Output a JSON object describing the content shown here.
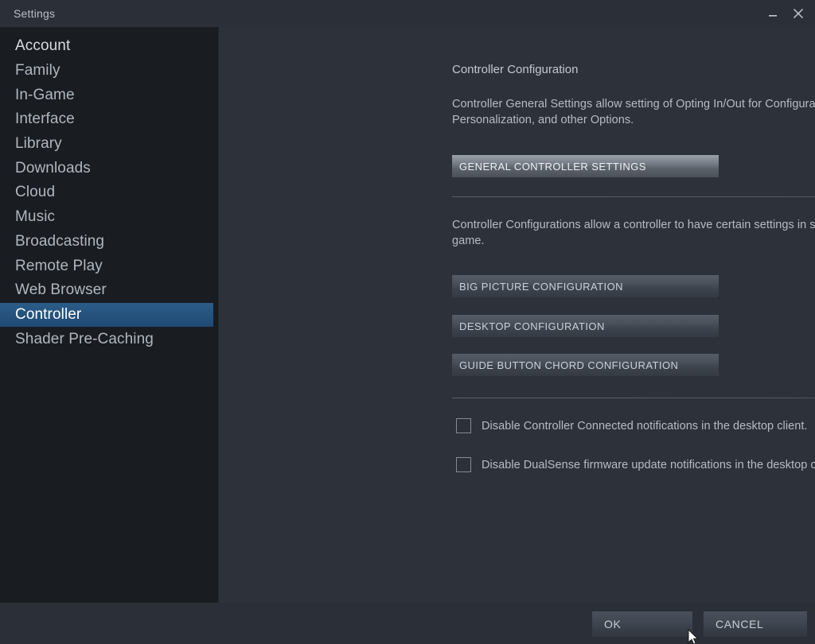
{
  "window": {
    "title": "Settings",
    "controls": [
      {
        "name": "minimize",
        "glyph": "minimize-icon"
      },
      {
        "name": "close",
        "glyph": "close-icon"
      }
    ]
  },
  "sidebar": {
    "items": [
      {
        "label": "Account",
        "selected": false
      },
      {
        "label": "Family",
        "selected": false
      },
      {
        "label": "In-Game",
        "selected": false
      },
      {
        "label": "Interface",
        "selected": false
      },
      {
        "label": "Library",
        "selected": false
      },
      {
        "label": "Downloads",
        "selected": false
      },
      {
        "label": "Cloud",
        "selected": false
      },
      {
        "label": "Music",
        "selected": false
      },
      {
        "label": "Broadcasting",
        "selected": false
      },
      {
        "label": "Remote Play",
        "selected": false
      },
      {
        "label": "Web Browser",
        "selected": false
      },
      {
        "label": "Controller",
        "selected": true
      },
      {
        "label": "Shader Pre-Caching",
        "selected": false
      }
    ],
    "selected_label": "Controller"
  },
  "main": {
    "section_title": "Controller Configuration",
    "description_1": "Controller General Settings allow setting of Opting In/Out for Configuration Support, Personalization, and other Options.",
    "general_settings_button": "GENERAL CONTROLLER SETTINGS",
    "description_2": "Controller Configurations allow a controller to have certain settings in specific contexts outside of game.",
    "big_picture_button": "BIG PICTURE CONFIGURATION",
    "desktop_button": "DESKTOP CONFIGURATION",
    "guide_button": "GUIDE BUTTON CHORD CONFIGURATION",
    "checkboxes": [
      {
        "label": "Disable Controller Connected notifications in the desktop client.",
        "checked": false
      },
      {
        "label": "Disable DualSense firmware update notifications in the desktop client.",
        "checked": false
      }
    ]
  },
  "footer": {
    "ok_label": "OK",
    "cancel_label": "CANCEL"
  },
  "colors": {
    "window_background": "#2a2f38",
    "content_background": "#2c313a",
    "sidebar_background": "#191c21",
    "selection_blue": "#2b5c88",
    "text_primary": "#c3c9d1",
    "text_secondary": "#b6bcc4",
    "button_hot": "#9aa1a9",
    "button_normal": "#4b515a"
  }
}
